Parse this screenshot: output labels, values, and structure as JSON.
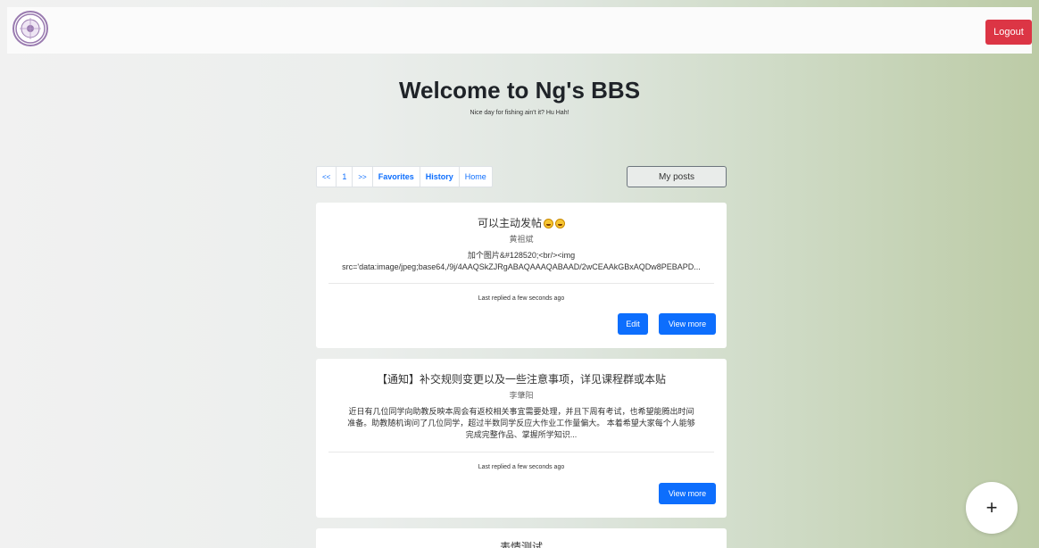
{
  "header": {
    "logout_label": "Logout"
  },
  "hero": {
    "title": "Welcome to Ng's BBS",
    "subtitle": "Nice day for fishing ain't it? Hu Hah!"
  },
  "pager": {
    "first": "<<",
    "page": "1",
    "last": ">>",
    "favorites": "Favorites",
    "history": "History",
    "home": "Home"
  },
  "my_posts_label": "My posts",
  "posts": [
    {
      "title": "可以主动发帖",
      "author": "黄祖斌",
      "body_line1": "加个图片&#128520;<br/><img",
      "body_line2": "src='data:image/jpeg;base64,/9j/4AAQSkZJRgABAQAAAQABAAD/2wCEAAkGBxAQDw8PEBAPD...",
      "replied": "Last replied a few seconds ago",
      "edit_label": "Edit",
      "view_label": "View more"
    },
    {
      "title": "【通知】补交规则变更以及一些注意事项，详见课程群或本贴",
      "author": "李肇阳",
      "body_line1": "近日有几位同学向助教反映本周会有返校相关事宜需要处理，并且下周有考试，也希望能腾出时间",
      "body_line2": "准备。助教随机询问了几位同学，超过半数同学反应大作业工作量偏大。 本着希望大家每个人能够",
      "body_line3": "完成完整作品、掌握所学知识...",
      "replied": "Last replied a few seconds ago",
      "view_label": "View more"
    },
    {
      "title": "表情测试"
    }
  ],
  "fab_label": "+"
}
